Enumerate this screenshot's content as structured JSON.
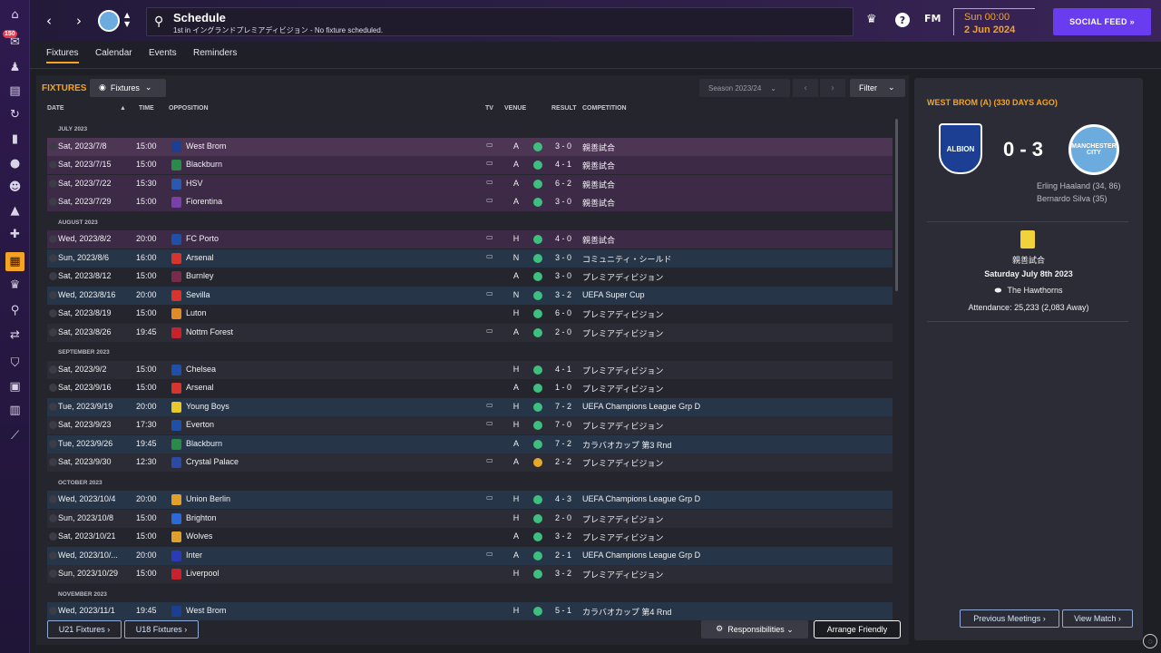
{
  "sidebar": {
    "badge": "150",
    "icons": [
      "home-icon",
      "inbox-icon",
      "squad-icon",
      "tactics-icon",
      "training-icon",
      "medical-icon",
      "dynamics-icon",
      "staff-icon",
      "scouting-icon",
      "development-icon",
      "schedule-icon",
      "competitions-icon",
      "search-icon",
      "transfers-icon",
      "club-icon",
      "finances-icon",
      "data-hub-icon",
      "recruitment-icon"
    ]
  },
  "header": {
    "back_glyph": "‹",
    "forward_glyph": "›",
    "title": "Schedule",
    "subtitle": "1st in イングランドプレミアディビジョン - No fixture scheduled.",
    "fm_logo": "FM",
    "date_day": "Sun 00:00",
    "date_date": "2 Jun 2024",
    "social_feed": "SOCIAL FEED  »",
    "help": "?"
  },
  "tabs": [
    "Fixtures",
    "Calendar",
    "Events",
    "Reminders"
  ],
  "fixtures": {
    "title": "FIXTURES",
    "dropdown": "Fixtures",
    "season": "Season 2023/24",
    "filter": "Filter",
    "columns": {
      "date": "DATE",
      "time": "TIME",
      "opposition": "OPPOSITION",
      "tv": "TV",
      "venue": "VENUE",
      "result": "RESULT",
      "competition": "COMPETITION"
    },
    "rows": [
      {
        "type": "month",
        "label": "JULY 2023"
      },
      {
        "date": "Sat, 2023/7/8",
        "time": "15:00",
        "opp": "West Brom",
        "tv": true,
        "venue": "A",
        "result": "3 - 0",
        "comp": "親善試合",
        "bg": "sel",
        "crest": "#1c3f94",
        "dot": "#3fbf7f"
      },
      {
        "date": "Sat, 2023/7/15",
        "time": "15:00",
        "opp": "Blackburn",
        "tv": true,
        "venue": "A",
        "result": "4 - 1",
        "comp": "親善試合",
        "bg": "purple",
        "crest": "#2a8a4a",
        "dot": "#3fbf7f"
      },
      {
        "date": "Sat, 2023/7/22",
        "time": "15:30",
        "opp": "HSV",
        "tv": true,
        "venue": "A",
        "result": "6 - 2",
        "comp": "親善試合",
        "bg": "purple",
        "crest": "#2a5ab0",
        "dot": "#3fbf7f"
      },
      {
        "date": "Sat, 2023/7/29",
        "time": "15:00",
        "opp": "Fiorentina",
        "tv": true,
        "venue": "A",
        "result": "3 - 0",
        "comp": "親善試合",
        "bg": "purple",
        "crest": "#7a3fa8",
        "dot": "#3fbf7f"
      },
      {
        "type": "month",
        "label": "AUGUST 2023"
      },
      {
        "date": "Wed, 2023/8/2",
        "time": "20:00",
        "opp": "FC Porto",
        "tv": true,
        "venue": "H",
        "result": "4 - 0",
        "comp": "親善試合",
        "bg": "purple",
        "crest": "#1f4fa8",
        "dot": "#3fbf7f"
      },
      {
        "date": "Sun, 2023/8/6",
        "time": "16:00",
        "opp": "Arsenal",
        "tv": true,
        "venue": "N",
        "result": "3 - 0",
        "comp": "コミュニティ・シールド",
        "bg": "blue",
        "crest": "#d8342e",
        "dot": "#3fbf7f"
      },
      {
        "date": "Sat, 2023/8/12",
        "time": "15:00",
        "opp": "Burnley",
        "tv": false,
        "venue": "A",
        "result": "3 - 0",
        "comp": "プレミアディビジョン",
        "bg": "dark",
        "crest": "#7a2a4a",
        "dot": "#3fbf7f"
      },
      {
        "date": "Wed, 2023/8/16",
        "time": "20:00",
        "opp": "Sevilla",
        "tv": true,
        "venue": "N",
        "result": "3 - 2",
        "comp": "UEFA Super Cup",
        "bg": "blue",
        "crest": "#d8342e",
        "dot": "#3fbf7f"
      },
      {
        "date": "Sat, 2023/8/19",
        "time": "15:00",
        "opp": "Luton",
        "tv": false,
        "venue": "H",
        "result": "6 - 0",
        "comp": "プレミアディビジョン",
        "bg": "dark",
        "crest": "#e08a2a",
        "dot": "#3fbf7f"
      },
      {
        "date": "Sat, 2023/8/26",
        "time": "19:45",
        "opp": "Nottm Forest",
        "tv": true,
        "venue": "A",
        "result": "2 - 0",
        "comp": "プレミアディビジョン",
        "bg": "mid",
        "crest": "#c8232c",
        "dot": "#3fbf7f"
      },
      {
        "type": "month",
        "label": "SEPTEMBER 2023"
      },
      {
        "date": "Sat, 2023/9/2",
        "time": "15:00",
        "opp": "Chelsea",
        "tv": false,
        "venue": "H",
        "result": "4 - 1",
        "comp": "プレミアディビジョン",
        "bg": "mid",
        "crest": "#1f4fa8",
        "dot": "#3fbf7f"
      },
      {
        "date": "Sat, 2023/9/16",
        "time": "15:00",
        "opp": "Arsenal",
        "tv": false,
        "venue": "A",
        "result": "1 - 0",
        "comp": "プレミアディビジョン",
        "bg": "dark",
        "crest": "#d8342e",
        "dot": "#3fbf7f"
      },
      {
        "date": "Tue, 2023/9/19",
        "time": "20:00",
        "opp": "Young Boys",
        "tv": true,
        "venue": "H",
        "result": "7 - 2",
        "comp": "UEFA Champions League Grp D",
        "bg": "blue",
        "crest": "#e8c82a",
        "dot": "#3fbf7f"
      },
      {
        "date": "Sat, 2023/9/23",
        "time": "17:30",
        "opp": "Everton",
        "tv": true,
        "venue": "H",
        "result": "7 - 0",
        "comp": "プレミアディビジョン",
        "bg": "mid",
        "crest": "#1f4fa8",
        "dot": "#3fbf7f"
      },
      {
        "date": "Tue, 2023/9/26",
        "time": "19:45",
        "opp": "Blackburn",
        "tv": false,
        "venue": "A",
        "result": "7 - 2",
        "comp": "カラバオカップ 第3 Rnd",
        "bg": "blue",
        "crest": "#2a8a4a",
        "dot": "#3fbf7f"
      },
      {
        "date": "Sat, 2023/9/30",
        "time": "12:30",
        "opp": "Crystal Palace",
        "tv": true,
        "venue": "A",
        "result": "2 - 2",
        "comp": "プレミアディビジョン",
        "bg": "mid",
        "crest": "#2a4aa8",
        "dot": "#e8a82a"
      },
      {
        "type": "month",
        "label": "OCTOBER 2023"
      },
      {
        "date": "Wed, 2023/10/4",
        "time": "20:00",
        "opp": "Union Berlin",
        "tv": true,
        "venue": "H",
        "result": "4 - 3",
        "comp": "UEFA Champions League Grp D",
        "bg": "blue",
        "crest": "#e0a02a",
        "dot": "#3fbf7f"
      },
      {
        "date": "Sun, 2023/10/8",
        "time": "15:00",
        "opp": "Brighton",
        "tv": false,
        "venue": "H",
        "result": "2 - 0",
        "comp": "プレミアディビジョン",
        "bg": "mid",
        "crest": "#2a6ad8",
        "dot": "#3fbf7f"
      },
      {
        "date": "Sat, 2023/10/21",
        "time": "15:00",
        "opp": "Wolves",
        "tv": false,
        "venue": "A",
        "result": "3 - 2",
        "comp": "プレミアディビジョン",
        "bg": "dark",
        "crest": "#e0a02a",
        "dot": "#3fbf7f"
      },
      {
        "date": "Wed, 2023/10/...",
        "time": "20:00",
        "opp": "Inter",
        "tv": true,
        "venue": "A",
        "result": "2 - 1",
        "comp": "UEFA Champions League Grp D",
        "bg": "blue",
        "crest": "#2a3ab8",
        "dot": "#3fbf7f"
      },
      {
        "date": "Sun, 2023/10/29",
        "time": "15:00",
        "opp": "Liverpool",
        "tv": false,
        "venue": "H",
        "result": "3 - 2",
        "comp": "プレミアディビジョン",
        "bg": "mid",
        "crest": "#c8232c",
        "dot": "#3fbf7f"
      },
      {
        "type": "month",
        "label": "NOVEMBER 2023"
      },
      {
        "date": "Wed, 2023/11/1",
        "time": "19:45",
        "opp": "West Brom",
        "tv": false,
        "venue": "H",
        "result": "5 - 1",
        "comp": "カラバオカップ 第4 Rnd",
        "bg": "blue",
        "crest": "#1c3f94",
        "dot": "#3fbf7f"
      }
    ],
    "u21_btn": "U21 Fixtures ›",
    "u18_btn": "U18 Fixtures ›",
    "responsibilities": "Responsibilities ⌄",
    "arrange_friendly": "Arrange Friendly"
  },
  "side_panel": {
    "title": "WEST BROM (A) (330 DAYS AGO)",
    "home_crest_text": "ALBION",
    "away_crest_text": "MANCHESTER CITY",
    "score": "0 - 3",
    "scorer1": "Erling Haaland (34, 86)",
    "scorer2": "Bernardo Silva (35)",
    "competition": "親善試合",
    "match_date": "Saturday July 8th 2023",
    "venue": "The Hawthorns",
    "attendance": "Attendance: 25,233 (2,083 Away)",
    "previous_meetings": "Previous Meetings ›",
    "view_match": "View Match ›"
  },
  "colors": {
    "accent": "#f4a325",
    "social": "#6a3cf0",
    "win": "#3fbf7f",
    "draw": "#e8a82a"
  }
}
